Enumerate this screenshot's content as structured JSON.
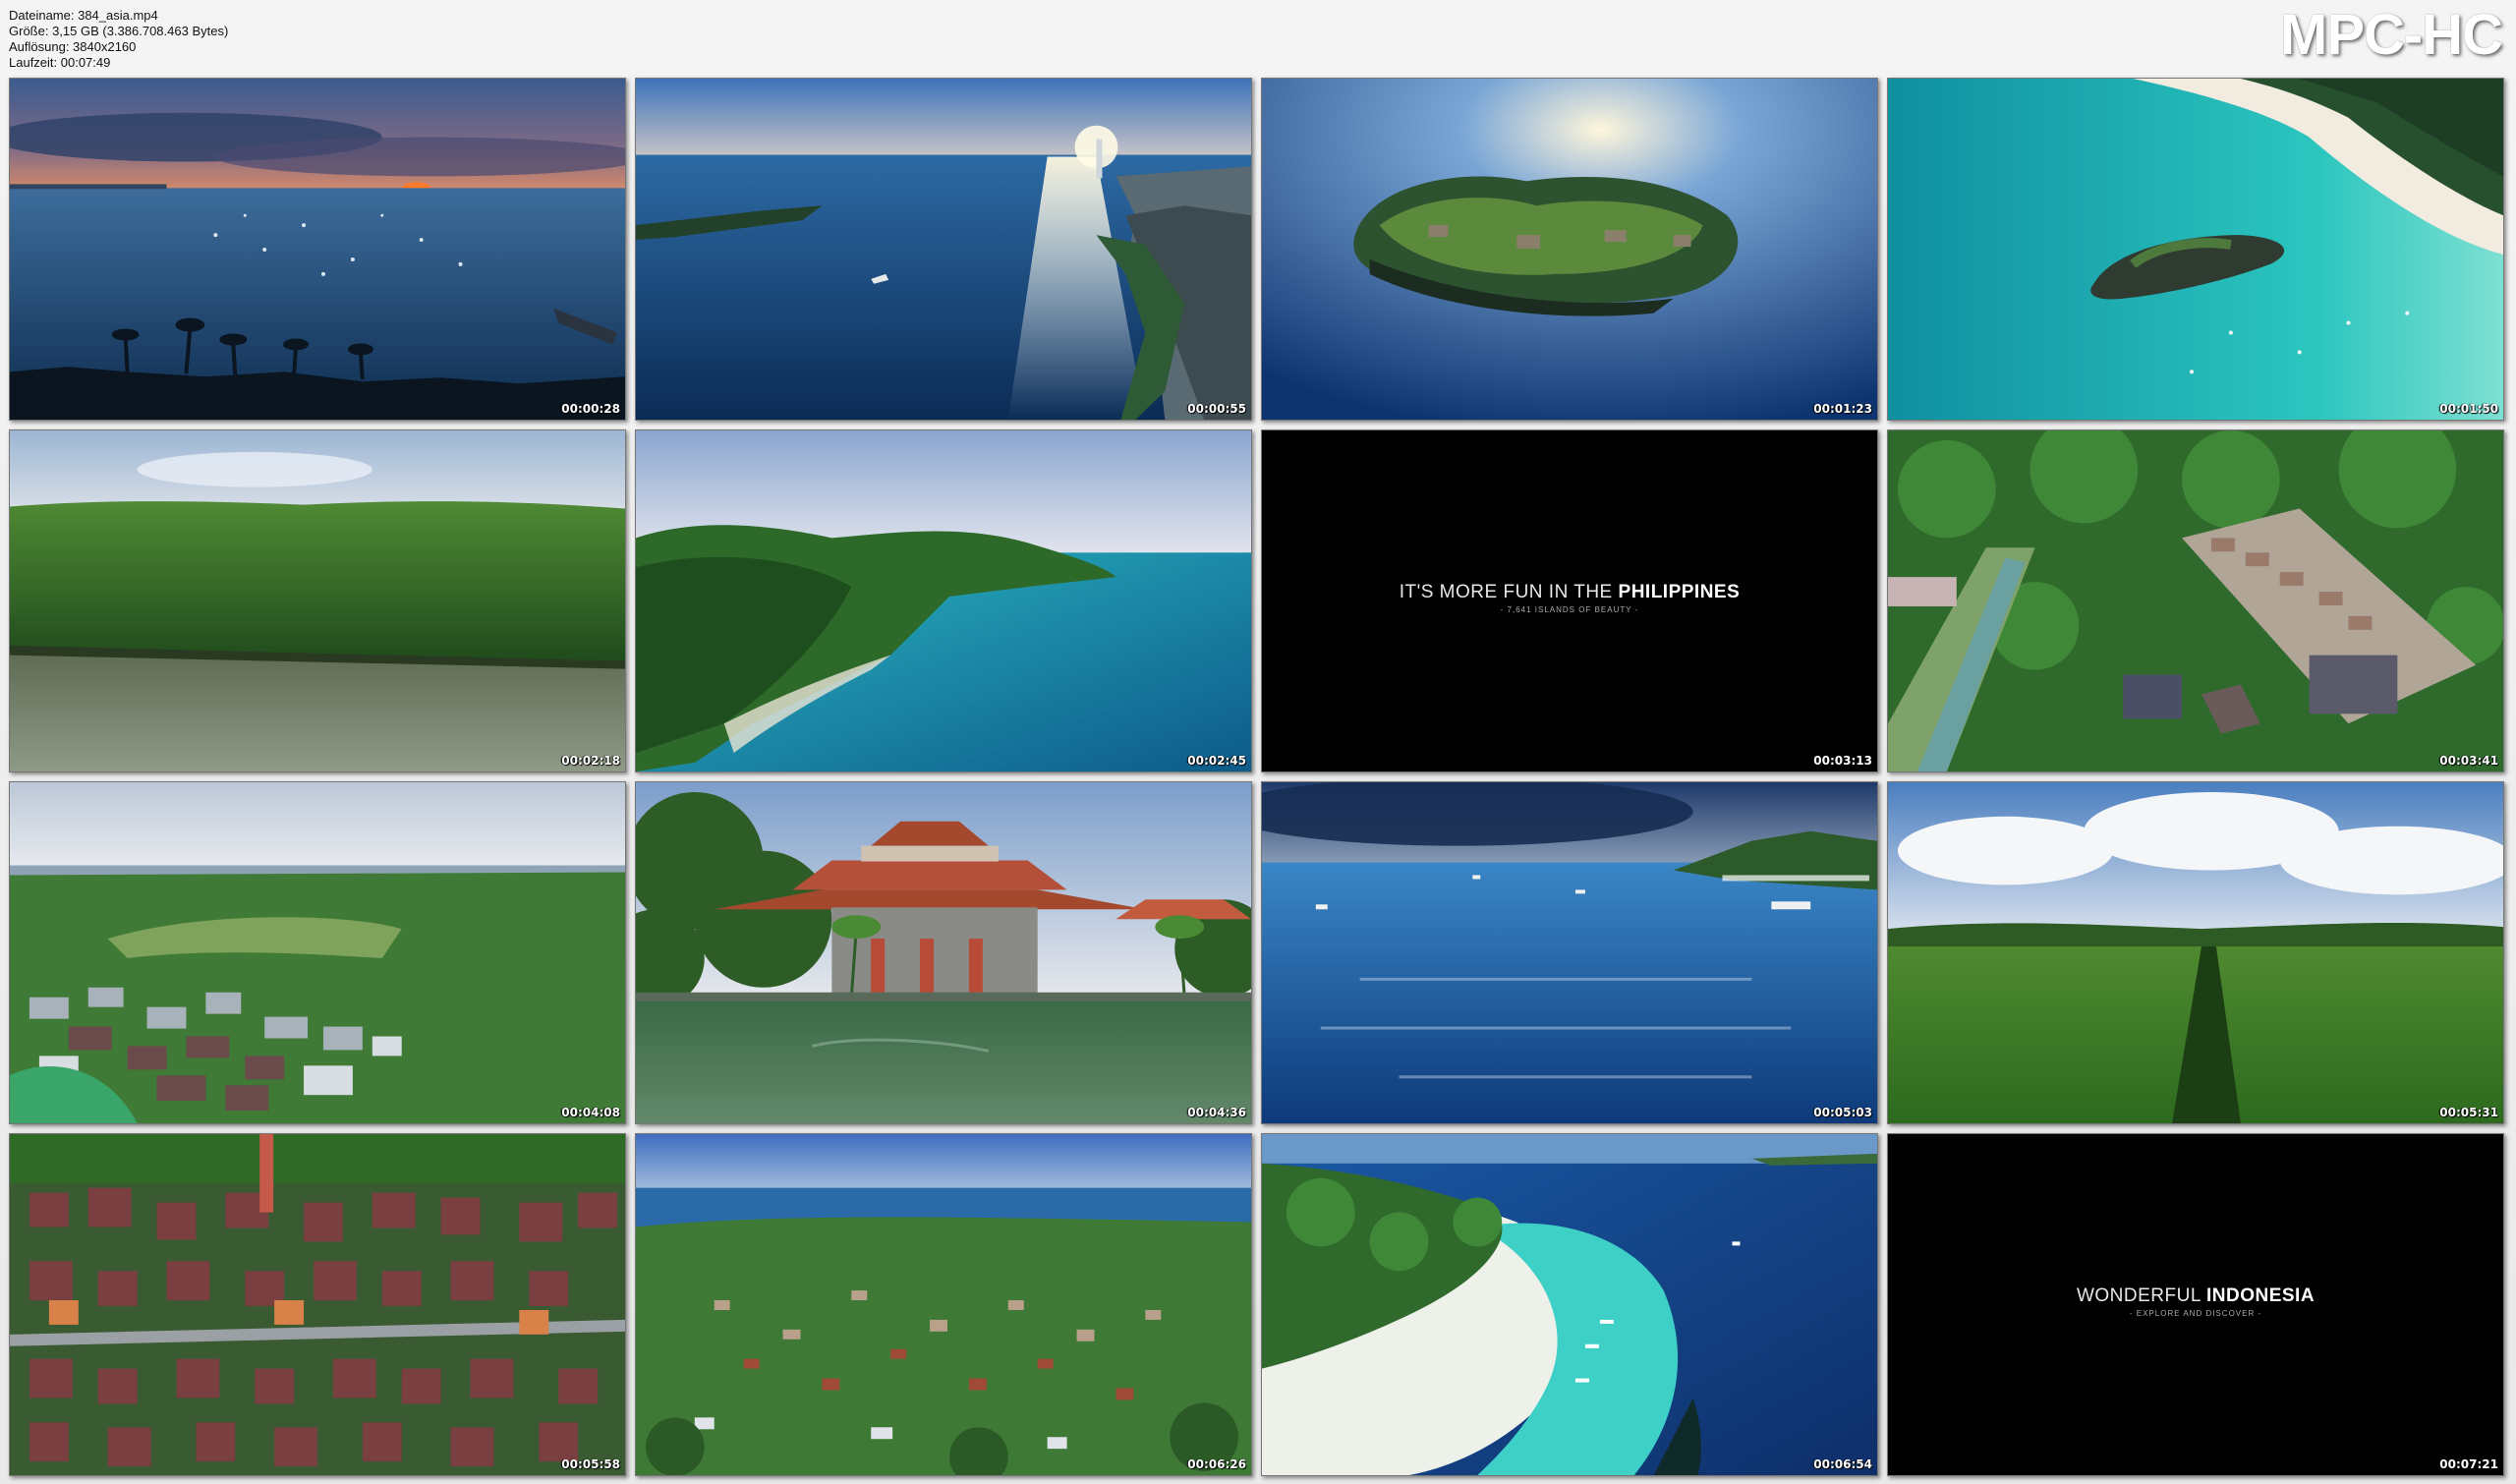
{
  "file_info": {
    "filename": "Dateiname: 384_asia.mp4",
    "size": "Größe: 3,15 GB (3.386.708.463 Bytes)",
    "resolution": "Auflösung: 3840x2160",
    "duration": "Laufzeit: 00:07:49"
  },
  "brand": "MPC-HC",
  "thumbnails": [
    {
      "time": "00:00:28",
      "scene": "sunset-bay"
    },
    {
      "time": "00:00:55",
      "scene": "coastal-city"
    },
    {
      "time": "00:01:23",
      "scene": "rock-island"
    },
    {
      "time": "00:01:50",
      "scene": "turquoise-beach"
    },
    {
      "time": "00:02:18",
      "scene": "mangrove-river"
    },
    {
      "time": "00:02:45",
      "scene": "green-headland"
    },
    {
      "time": "00:03:13",
      "scene": "title-card",
      "title_pre": "IT'S MORE FUN IN THE ",
      "title_bold": "PHILIPPINES",
      "subtitle": "- 7,641 ISLANDS OF BEAUTY -"
    },
    {
      "time": "00:03:41",
      "scene": "temple-complex"
    },
    {
      "time": "00:04:08",
      "scene": "village-coast"
    },
    {
      "time": "00:04:36",
      "scene": "pagoda-building"
    },
    {
      "time": "00:05:03",
      "scene": "blue-sea-boats"
    },
    {
      "time": "00:05:31",
      "scene": "rice-field"
    },
    {
      "time": "00:05:58",
      "scene": "red-roof-village"
    },
    {
      "time": "00:06:26",
      "scene": "town-aerial"
    },
    {
      "time": "00:06:54",
      "scene": "sand-spit"
    },
    {
      "time": "00:07:21",
      "scene": "title-card",
      "title_pre": "WONDERFUL ",
      "title_bold": "INDONESIA",
      "subtitle": "- EXPLORE AND DISCOVER -"
    }
  ]
}
